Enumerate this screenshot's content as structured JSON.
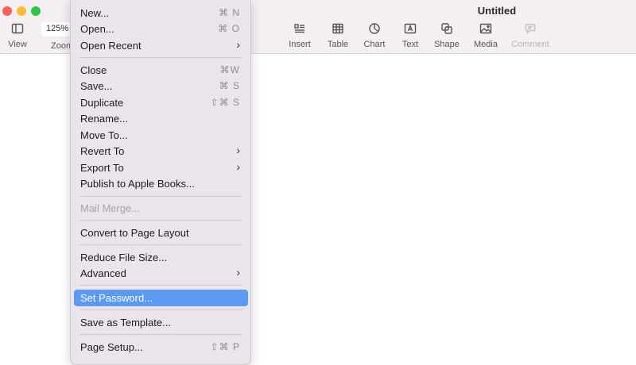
{
  "window": {
    "title": "Untitled"
  },
  "toolbar": {
    "view_label": "View",
    "zoom_value": "125%",
    "zoom_label": "Zoom",
    "insert_label": "Insert",
    "table_label": "Table",
    "chart_label": "Chart",
    "text_label": "Text",
    "shape_label": "Shape",
    "media_label": "Media",
    "comment_label": "Comment"
  },
  "menu": {
    "items": [
      {
        "label": "New...",
        "shortcut": "⌘ N"
      },
      {
        "label": "Open...",
        "shortcut": "⌘ O"
      },
      {
        "label": "Open Recent",
        "submenu": "›"
      },
      {
        "label": "Close",
        "shortcut": "⌘W"
      },
      {
        "label": "Save...",
        "shortcut": "⌘ S"
      },
      {
        "label": "Duplicate",
        "shortcut": "⇧⌘ S"
      },
      {
        "label": "Rename..."
      },
      {
        "label": "Move To..."
      },
      {
        "label": "Revert To",
        "submenu": "›"
      },
      {
        "label": "Export To",
        "submenu": "›"
      },
      {
        "label": "Publish to Apple Books..."
      },
      {
        "label": "Mail Merge..."
      },
      {
        "label": "Convert to Page Layout"
      },
      {
        "label": "Reduce File Size..."
      },
      {
        "label": "Advanced",
        "submenu": "›"
      },
      {
        "label": "Set Password..."
      },
      {
        "label": "Save as Template..."
      },
      {
        "label": "Page Setup...",
        "shortcut": "⇧⌘ P"
      }
    ]
  }
}
